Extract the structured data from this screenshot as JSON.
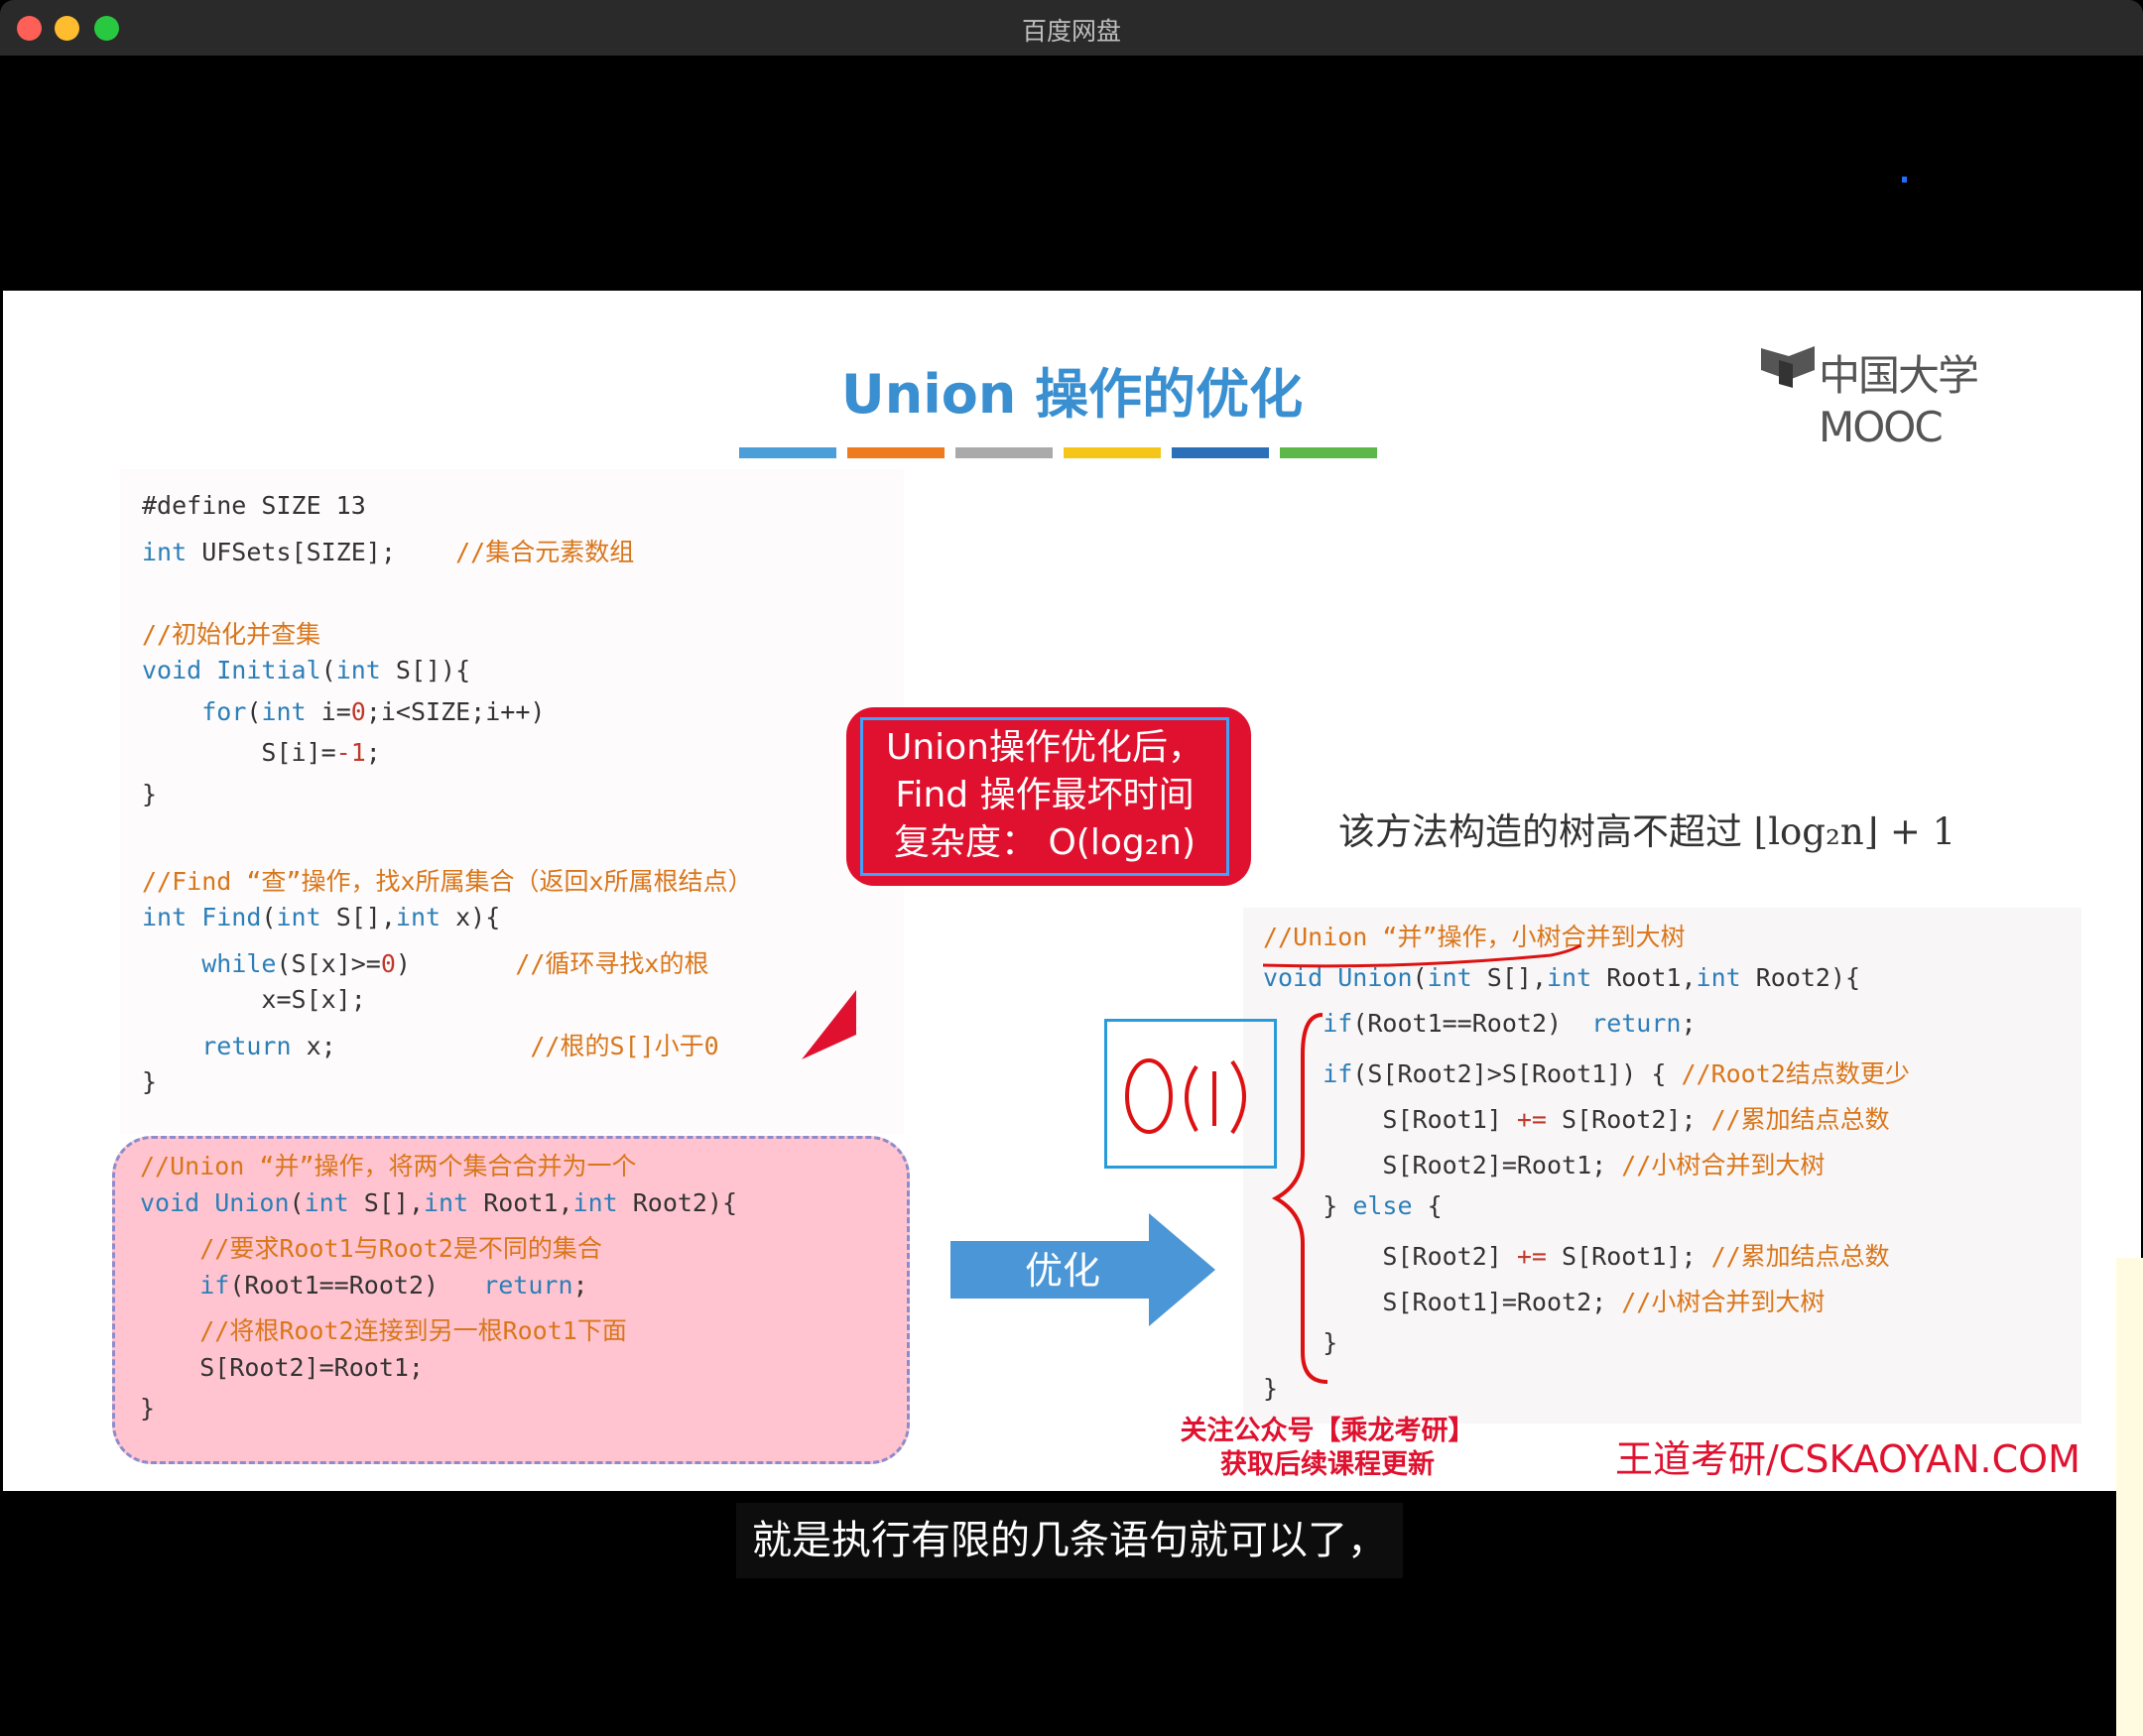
{
  "window": {
    "title": "百度网盘"
  },
  "slide": {
    "title": "Union 操作的优化",
    "logo_text": "中国大学MOOC",
    "color_bar": [
      "#4a9fd8",
      "#ee7b1e",
      "#aaaaaa",
      "#f5c518",
      "#2a6fb8",
      "#5cb848"
    ],
    "left_code": [
      {
        "parts": [
          [
            "pl",
            "#define SIZE 13"
          ]
        ]
      },
      {
        "parts": [
          [
            "kw",
            "int"
          ],
          [
            "pl",
            " UFSets[SIZE];    "
          ],
          [
            "cm",
            "//集合元素数组"
          ]
        ]
      },
      {
        "parts": []
      },
      {
        "parts": [
          [
            "cm",
            "//初始化并查集"
          ]
        ]
      },
      {
        "parts": [
          [
            "kw",
            "void Initial"
          ],
          [
            "pl",
            "("
          ],
          [
            "kw",
            "int"
          ],
          [
            "pl",
            " S[]){"
          ]
        ]
      },
      {
        "parts": [
          [
            "pl",
            "    "
          ],
          [
            "kw",
            "for"
          ],
          [
            "pl",
            "("
          ],
          [
            "kw",
            "int"
          ],
          [
            "pl",
            " i="
          ],
          [
            "num",
            "0"
          ],
          [
            "pl",
            ";i<SIZE;i++)"
          ]
        ]
      },
      {
        "parts": [
          [
            "pl",
            "        S[i]="
          ],
          [
            "num",
            "-1"
          ],
          [
            "pl",
            ";"
          ]
        ]
      },
      {
        "parts": [
          [
            "pl",
            "}"
          ]
        ]
      },
      {
        "parts": []
      },
      {
        "parts": [
          [
            "cm",
            "//Find “查”操作，找x所属集合（返回x所属根结点）"
          ]
        ]
      },
      {
        "parts": [
          [
            "kw",
            "int Find"
          ],
          [
            "pl",
            "("
          ],
          [
            "kw",
            "int"
          ],
          [
            "pl",
            " S[],"
          ],
          [
            "kw",
            "int"
          ],
          [
            "pl",
            " x){"
          ]
        ]
      },
      {
        "parts": [
          [
            "pl",
            "    "
          ],
          [
            "kw",
            "while"
          ],
          [
            "pl",
            "(S[x]>="
          ],
          [
            "num",
            "0"
          ],
          [
            "pl",
            ")       "
          ],
          [
            "cm",
            "//循环寻找x的根"
          ]
        ]
      },
      {
        "parts": [
          [
            "pl",
            "        x=S[x];"
          ]
        ]
      },
      {
        "parts": [
          [
            "pl",
            "    "
          ],
          [
            "kw",
            "return"
          ],
          [
            "pl",
            " x;             "
          ],
          [
            "cm",
            "//根的S[]小于0"
          ]
        ]
      },
      {
        "parts": [
          [
            "pl",
            "}"
          ]
        ]
      }
    ],
    "pink_code": [
      {
        "parts": [
          [
            "cm",
            "//Union “并”操作，将两个集合合并为一个"
          ]
        ]
      },
      {
        "parts": [
          [
            "kw",
            "void Union"
          ],
          [
            "pl",
            "("
          ],
          [
            "kw",
            "int"
          ],
          [
            "pl",
            " S[],"
          ],
          [
            "kw",
            "int"
          ],
          [
            "pl",
            " Root1,"
          ],
          [
            "kw",
            "int"
          ],
          [
            "pl",
            " Root2){"
          ]
        ]
      },
      {
        "parts": [
          [
            "pl",
            "    "
          ],
          [
            "cm",
            "//要求Root1与Root2是不同的集合"
          ]
        ]
      },
      {
        "parts": [
          [
            "pl",
            "    "
          ],
          [
            "kw",
            "if"
          ],
          [
            "pl",
            "(Root1==Root2)   "
          ],
          [
            "kw",
            "return"
          ],
          [
            "pl",
            ";"
          ]
        ]
      },
      {
        "parts": [
          [
            "pl",
            "    "
          ],
          [
            "cm",
            "//将根Root2连接到另一根Root1下面"
          ]
        ]
      },
      {
        "parts": [
          [
            "pl",
            "    S[Root2]=Root1;"
          ]
        ]
      },
      {
        "parts": [
          [
            "pl",
            "}"
          ]
        ]
      }
    ],
    "callout_lines": [
      "Union操作优化后，",
      "Find 操作最坏时间",
      "复杂度： O(log₂n)"
    ],
    "complexity_text": "该方法构造的树高不超过 ⌊log₂n⌋ + 1",
    "right_code": [
      {
        "parts": [
          [
            "cm",
            "//Union “并”操作，小树合并到大树"
          ]
        ]
      },
      {
        "parts": [
          [
            "kw",
            "void Union"
          ],
          [
            "pl",
            "("
          ],
          [
            "kw",
            "int"
          ],
          [
            "pl",
            " S[],"
          ],
          [
            "kw",
            "int"
          ],
          [
            "pl",
            " Root1,"
          ],
          [
            "kw",
            "int"
          ],
          [
            "pl",
            " Root2){"
          ]
        ]
      },
      {
        "parts": [
          [
            "pl",
            "    "
          ],
          [
            "kw",
            "if"
          ],
          [
            "pl",
            "(Root1==Root2)  "
          ],
          [
            "kw",
            "return"
          ],
          [
            "pl",
            ";"
          ]
        ]
      },
      {
        "parts": [
          [
            "pl",
            "    "
          ],
          [
            "kw",
            "if"
          ],
          [
            "pl",
            "(S[Root2]>S[Root1]) { "
          ],
          [
            "cm",
            "//Root2结点数更少"
          ]
        ]
      },
      {
        "parts": [
          [
            "pl",
            "        S[Root1] "
          ],
          [
            "num",
            "+="
          ],
          [
            "pl",
            " S[Root2]; "
          ],
          [
            "cm",
            "//累加结点总数"
          ]
        ]
      },
      {
        "parts": [
          [
            "pl",
            "        S[Root2]=Root1; "
          ],
          [
            "cm",
            "//小树合并到大树"
          ]
        ]
      },
      {
        "parts": [
          [
            "pl",
            "    } "
          ],
          [
            "kw",
            "else"
          ],
          [
            "pl",
            " {"
          ]
        ]
      },
      {
        "parts": [
          [
            "pl",
            "        S[Root2] "
          ],
          [
            "num",
            "+="
          ],
          [
            "pl",
            " S[Root1]; "
          ],
          [
            "cm",
            "//累加结点总数"
          ]
        ]
      },
      {
        "parts": [
          [
            "pl",
            "        S[Root1]=Root2; "
          ],
          [
            "cm",
            "//小树合并到大树"
          ]
        ]
      },
      {
        "parts": [
          [
            "pl",
            "    }"
          ]
        ]
      },
      {
        "parts": [
          [
            "pl",
            "}"
          ]
        ]
      }
    ],
    "arrow_label": "优化",
    "handwritten": "O(1)",
    "promo_line1": "关注公众号【乘龙考研】",
    "promo_line2": "获取后续课程更新",
    "site": "王道考研/CSKAOYAN.COM"
  },
  "subtitle": "就是执行有限的几条语句就可以了，"
}
